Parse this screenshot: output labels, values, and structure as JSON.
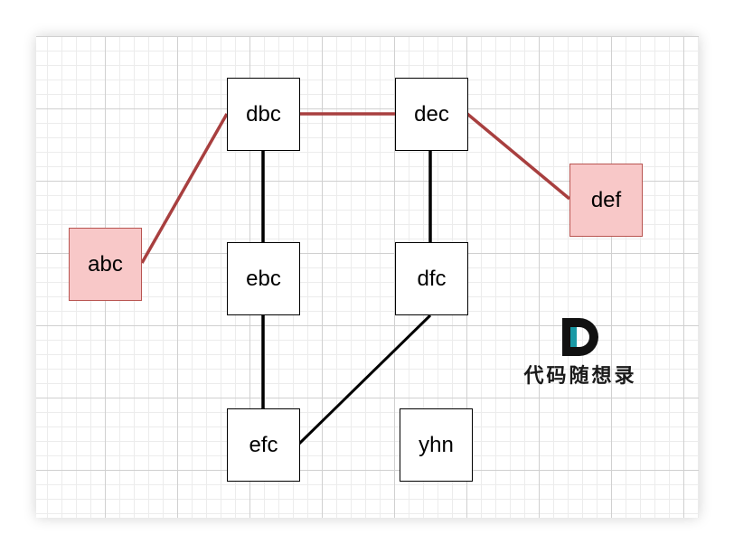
{
  "colors": {
    "highlight_fill": "#f8c8c8",
    "highlight_stroke": "#b85450",
    "highlight_edge": "#a83f3f",
    "normal_edge": "#000000",
    "logo_teal": "#1a9aa6"
  },
  "nodes": [
    {
      "id": "dbc",
      "label": "dbc",
      "highlight": false
    },
    {
      "id": "dec",
      "label": "dec",
      "highlight": false
    },
    {
      "id": "abc",
      "label": "abc",
      "highlight": true
    },
    {
      "id": "def",
      "label": "def",
      "highlight": true
    },
    {
      "id": "ebc",
      "label": "ebc",
      "highlight": false
    },
    {
      "id": "dfc",
      "label": "dfc",
      "highlight": false
    },
    {
      "id": "efc",
      "label": "efc",
      "highlight": false
    },
    {
      "id": "yhn",
      "label": "yhn",
      "highlight": false
    }
  ],
  "edges": [
    {
      "from": "abc",
      "to": "dbc",
      "highlight": true
    },
    {
      "from": "dbc",
      "to": "dec",
      "highlight": true
    },
    {
      "from": "dec",
      "to": "def",
      "highlight": true
    },
    {
      "from": "dbc",
      "to": "ebc",
      "highlight": false
    },
    {
      "from": "dec",
      "to": "dfc",
      "highlight": false
    },
    {
      "from": "ebc",
      "to": "efc",
      "highlight": false
    },
    {
      "from": "dfc",
      "to": "efc",
      "highlight": false
    }
  ],
  "logo": {
    "letter": "D",
    "text": "代码随想录"
  }
}
